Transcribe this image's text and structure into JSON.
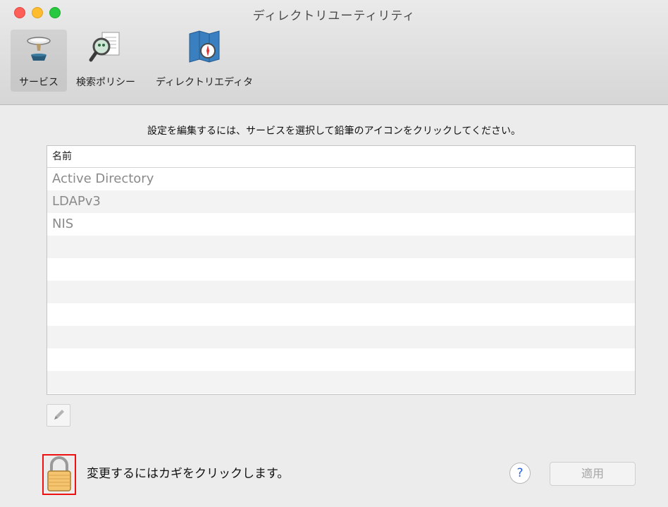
{
  "window": {
    "title": "ディレクトリユーティリティ"
  },
  "toolbar": {
    "tabs": [
      {
        "label": "サービス",
        "icon": "services-icon",
        "active": true
      },
      {
        "label": "検索ポリシー",
        "icon": "search-policy-icon",
        "active": false
      },
      {
        "label": "ディレクトリエディタ",
        "icon": "directory-editor-icon",
        "active": false
      }
    ]
  },
  "main": {
    "instruction": "設定を編集するには、サービスを選択して鉛筆のアイコンをクリックしてください。",
    "table": {
      "column_header": "名前",
      "rows": [
        "Active Directory",
        "LDAPv3",
        "NIS"
      ]
    },
    "edit_icon": "pencil-icon"
  },
  "footer": {
    "lock_text": "変更するにはカギをクリックします。",
    "help_label": "?",
    "apply_label": "適用"
  },
  "colors": {
    "lock_highlight": "#e11111",
    "help_accent": "#2563eb"
  }
}
